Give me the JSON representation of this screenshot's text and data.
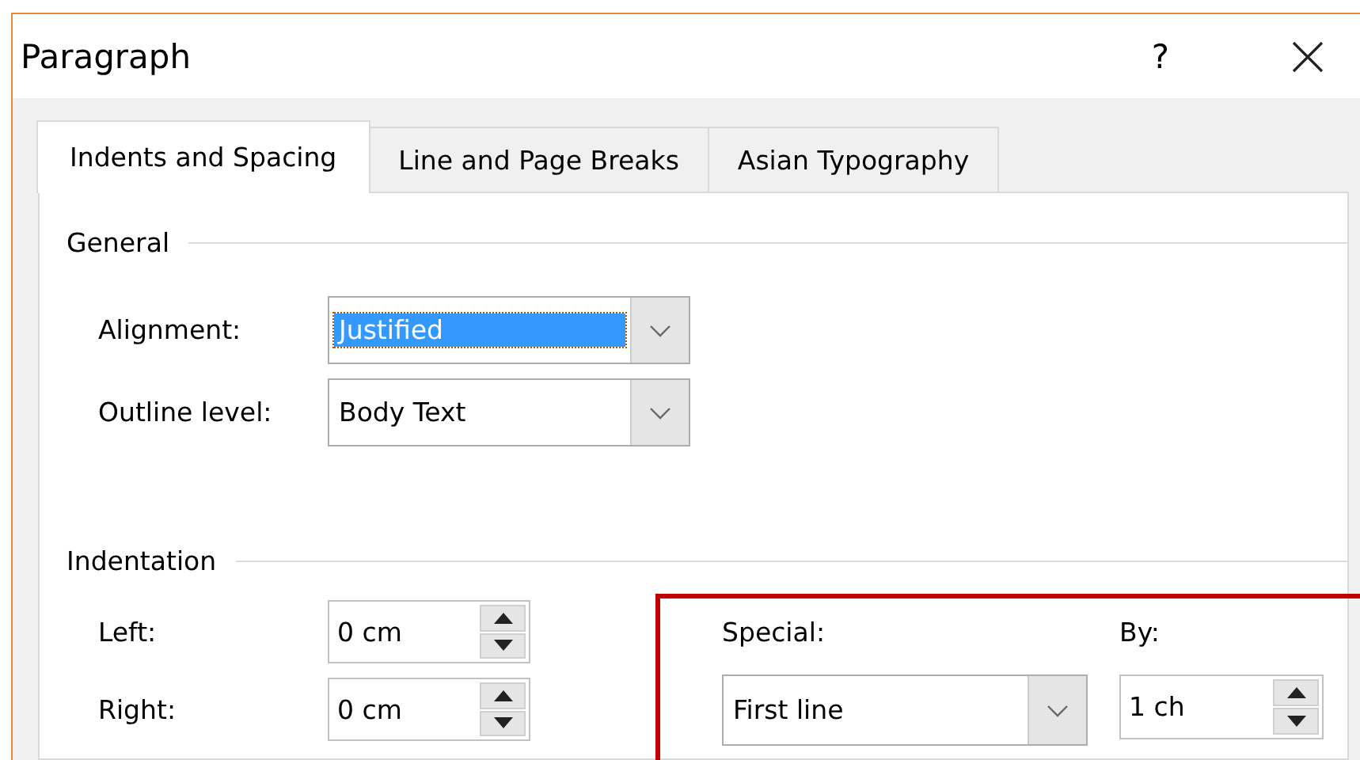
{
  "window": {
    "title": "Paragraph",
    "help": "?"
  },
  "tabs": [
    {
      "label": "Indents and Spacing",
      "selected": true
    },
    {
      "label": "Line and Page Breaks",
      "selected": false
    },
    {
      "label": "Asian Typography",
      "selected": false
    }
  ],
  "general": {
    "heading": "General",
    "fields": [
      {
        "kind": "combo",
        "label": "Alignment:",
        "value": "Justified",
        "focused": true
      },
      {
        "kind": "combo",
        "label": "Outline level:",
        "value": "Body Text",
        "focused": false
      }
    ]
  },
  "indentation": {
    "heading": "Indentation",
    "fields": [
      {
        "kind": "spin",
        "label": "Left:",
        "value": "0 cm"
      },
      {
        "kind": "spin",
        "label": "Right:",
        "value": "0 cm"
      }
    ],
    "special_fields": [
      {
        "kind": "combo",
        "label": "Special:",
        "value": "First line",
        "focused": false
      },
      {
        "kind": "spin",
        "label": "By:",
        "value": "1 ch"
      }
    ]
  }
}
